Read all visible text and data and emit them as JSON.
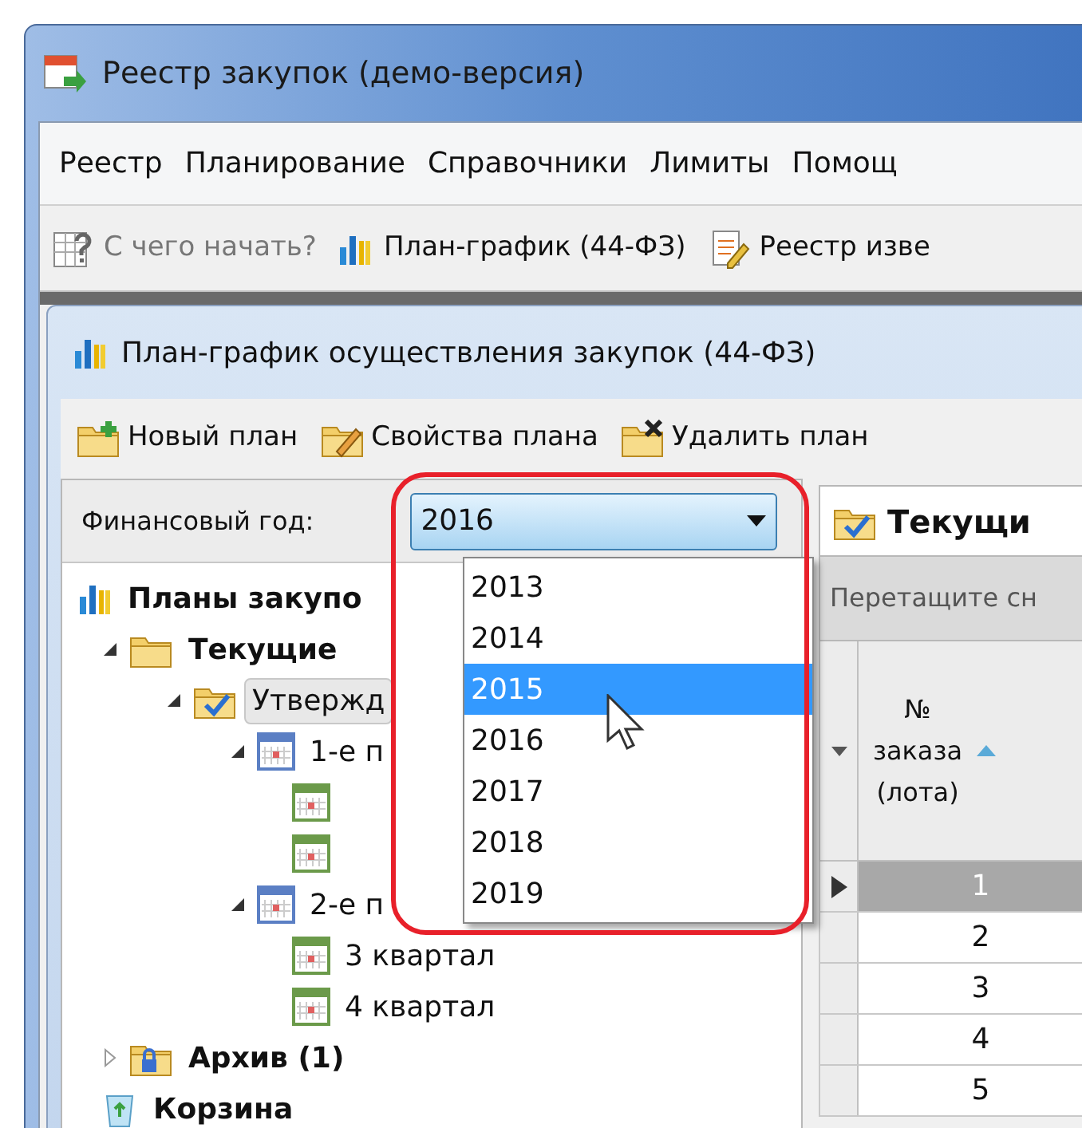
{
  "window": {
    "title": "Реестр закупок (демо-версия)"
  },
  "menu": [
    "Реестр",
    "Планирование",
    "Справочники",
    "Лимиты",
    "Помощ"
  ],
  "toolbar": [
    {
      "kind": "help",
      "label": "С чего начать?",
      "disabled": true
    },
    {
      "kind": "chart",
      "label": "План-график (44-ФЗ)",
      "disabled": false
    },
    {
      "kind": "registry",
      "label": "Реестр изве",
      "disabled": false
    }
  ],
  "child_window": {
    "title": "План-график осуществления закупок (44-ФЗ)"
  },
  "plan_toolbar": [
    {
      "kind": "new",
      "label": "Новый план"
    },
    {
      "kind": "edit",
      "label": "Свойства плана"
    },
    {
      "kind": "delete",
      "label": "Удалить план"
    }
  ],
  "fiscal_year": {
    "label": "Финансовый год:",
    "value": "2016",
    "expanded": true,
    "options": [
      {
        "label": "2013",
        "highlighted": false
      },
      {
        "label": "2014",
        "highlighted": false
      },
      {
        "label": "2015",
        "highlighted": true
      },
      {
        "label": "2016",
        "highlighted": false
      },
      {
        "label": "2017",
        "highlighted": false
      },
      {
        "label": "2018",
        "highlighted": false
      },
      {
        "label": "2019",
        "highlighted": false
      }
    ]
  },
  "tree": [
    {
      "kind": "root",
      "label": "Планы закупо",
      "children": [
        {
          "kind": "folder",
          "label": "Текущие",
          "expanded": true,
          "selected": false,
          "children": [
            {
              "kind": "approved",
              "label": "Утвержд",
              "expanded": true,
              "selected": true,
              "children": [
                {
                  "kind": "plan",
                  "label": "1-е п",
                  "expanded": true,
                  "selected": false,
                  "children": [
                    {
                      "kind": "quarter"
                    },
                    {
                      "kind": "quarter"
                    }
                  ]
                },
                {
                  "kind": "plan",
                  "label": "2-е п",
                  "expanded": true,
                  "selected": false,
                  "children": [
                    {
                      "kind": "quarter",
                      "label": "3 квартал"
                    },
                    {
                      "kind": "quarter",
                      "label": "4 квартал"
                    }
                  ]
                }
              ]
            }
          ]
        },
        {
          "kind": "archive",
          "label": "Архив (1)",
          "expanded": false,
          "selected": false
        },
        {
          "kind": "trash",
          "label": "Корзина",
          "selected": false
        }
      ]
    }
  ],
  "tab": {
    "label": "Текущи"
  },
  "group_panel": {
    "placeholder": "Перетащите сн"
  },
  "grid": {
    "columns": [
      "№ заказа (лота)"
    ],
    "rows": [
      {
        "cells": [
          "1"
        ],
        "selected": true
      },
      {
        "cells": [
          "2"
        ],
        "selected": false
      },
      {
        "cells": [
          "3"
        ],
        "selected": false
      },
      {
        "cells": [
          "4"
        ],
        "selected": false
      },
      {
        "cells": [
          "5"
        ],
        "selected": false
      }
    ]
  }
}
